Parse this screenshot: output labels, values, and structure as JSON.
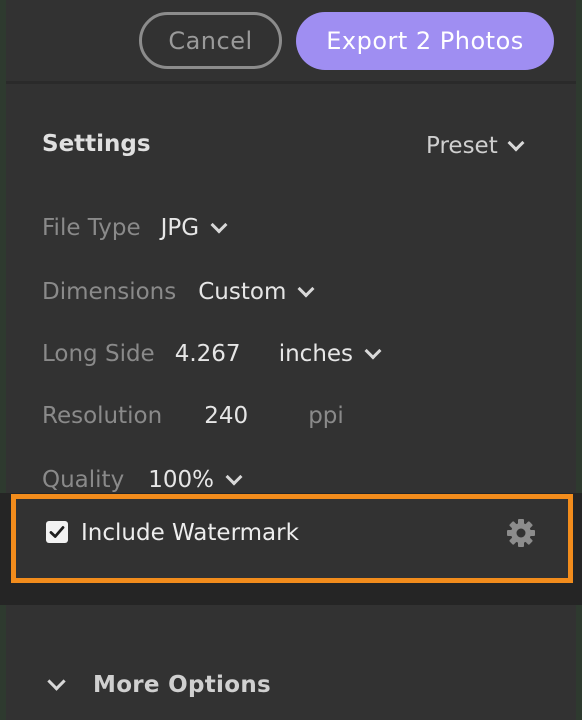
{
  "header": {
    "cancel_label": "Cancel",
    "export_label": "Export 2 Photos"
  },
  "settings": {
    "title": "Settings",
    "preset_label": "Preset",
    "file_type": {
      "label": "File Type",
      "value": "JPG"
    },
    "dimensions": {
      "label": "Dimensions",
      "value": "Custom"
    },
    "long_side": {
      "label": "Long Side",
      "value": "4.267",
      "unit": "inches"
    },
    "resolution": {
      "label": "Resolution",
      "value": "240",
      "unit": "ppi"
    },
    "quality": {
      "label": "Quality",
      "value": "100%"
    }
  },
  "watermark": {
    "label": "Include Watermark",
    "checked": true
  },
  "more_options": {
    "label": "More Options"
  },
  "colors": {
    "accent": "#9f8ef2",
    "highlight": "#f28c1c",
    "panel": "#323232"
  }
}
